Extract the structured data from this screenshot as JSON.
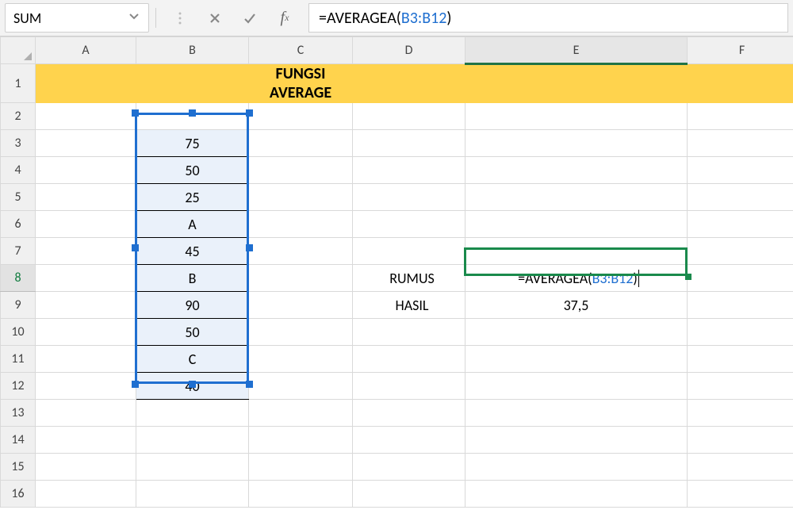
{
  "name_box": "SUM",
  "formula_bar": {
    "prefix": "=AVERAGEA(",
    "ref": "B3:B12",
    "suffix": ")"
  },
  "columns": [
    "A",
    "B",
    "C",
    "D",
    "E",
    "F"
  ],
  "rows": [
    "1",
    "2",
    "3",
    "4",
    "5",
    "6",
    "7",
    "8",
    "9",
    "10",
    "11",
    "12",
    "13",
    "14",
    "15",
    "16"
  ],
  "title": "FUNGSI AVERAGE",
  "data_column": [
    "75",
    "50",
    "25",
    "A",
    "45",
    "B",
    "90",
    "50",
    "C",
    "40"
  ],
  "block": {
    "rumus_label": "RUMUS",
    "hasil_label": "HASIL",
    "rumus_prefix": "=AVERAGEA(",
    "rumus_ref": "B3:B12",
    "rumus_suffix": ")",
    "hasil_value": "37,5"
  },
  "icons": {
    "dots": "dots-vertical-icon",
    "cancel": "cancel-icon",
    "enter": "check-icon",
    "fx": "fx-icon",
    "caret": "caret-down-icon"
  }
}
